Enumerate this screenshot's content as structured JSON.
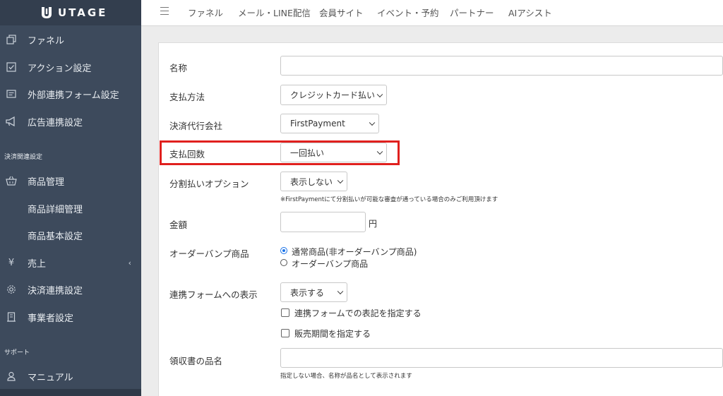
{
  "app": {
    "logo_text": "UTAGE"
  },
  "sidebar": {
    "items": [
      {
        "label": "ファネル",
        "icon": "copy-icon"
      },
      {
        "label": "アクション設定",
        "icon": "checkbox-icon"
      },
      {
        "label": "外部連携フォーム設定",
        "icon": "form-icon"
      },
      {
        "label": "広告連携設定",
        "icon": "megaphone-icon"
      }
    ],
    "section_payment": "決済関連設定",
    "payment_items": [
      {
        "label": "商品管理",
        "icon": "basket-icon"
      },
      {
        "label": "商品詳細管理"
      },
      {
        "label": "商品基本設定"
      },
      {
        "label": "売上",
        "icon": "yen-icon"
      },
      {
        "label": "決済連携設定",
        "icon": "gear-icon"
      },
      {
        "label": "事業者設定",
        "icon": "building-icon"
      }
    ],
    "section_support": "サポート",
    "support_items": [
      {
        "label": "マニュアル",
        "icon": "person-icon"
      }
    ]
  },
  "topbar": {
    "nav": [
      "ファネル",
      "メール・LINE配信",
      "会員サイト",
      "イベント・予約",
      "パートナー",
      "AIアシスト"
    ]
  },
  "form": {
    "name_label": "名称",
    "name_value": "",
    "payment_method_label": "支払方法",
    "payment_method_value": "クレジットカード払い",
    "agent_label": "決済代行会社",
    "agent_value": "FirstPayment",
    "installments_label": "支払回数",
    "installments_value": "一回払い",
    "split_option_label": "分割払いオプション",
    "split_option_value": "表示しない",
    "split_option_hint": "※FirstPaymentにて分割払いが可能な審査が通っている場合のみご利用頂けます",
    "amount_label": "金額",
    "amount_value": "",
    "amount_unit": "円",
    "orderbump_label": "オーダーバンプ商品",
    "orderbump_options": [
      "通常商品(非オーダーバンプ商品)",
      "オーダーバンプ商品"
    ],
    "orderbump_selected": 0,
    "form_display_label": "連携フォームへの表示",
    "form_display_value": "表示する",
    "checkbox_notation": "連携フォームでの表記を指定する",
    "checkbox_period": "販売期間を指定する",
    "receipt_label": "領収書の品名",
    "receipt_value": "",
    "receipt_hint": "指定しない場合、名称が品名として表示されます"
  },
  "colors": {
    "sidebar_bg": "#3d4a5c",
    "highlight": "#e0201e",
    "radio_on": "#1a73e8"
  }
}
